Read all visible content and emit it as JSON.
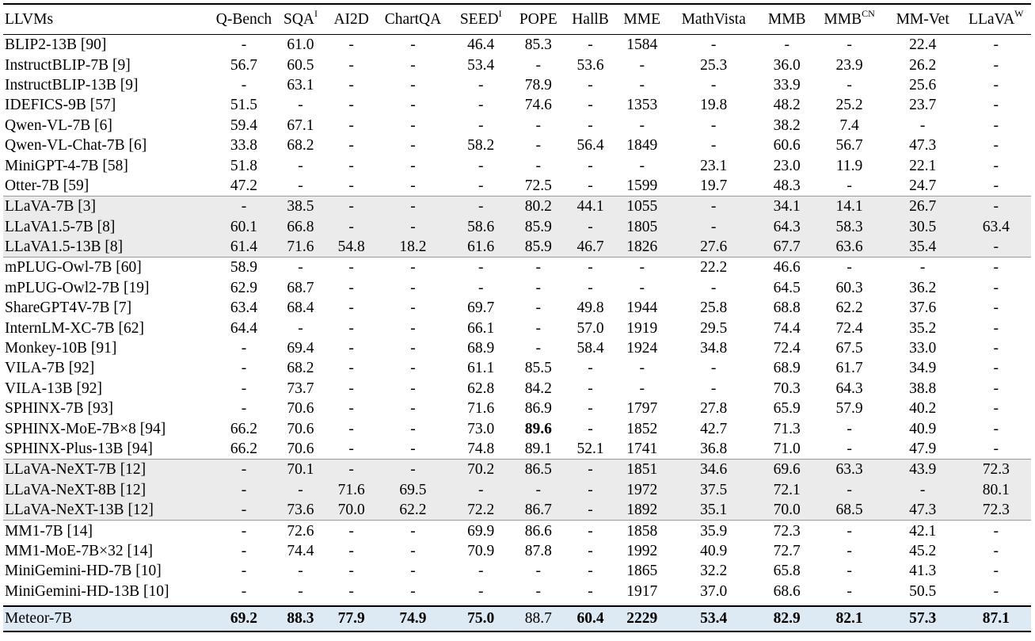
{
  "columns": [
    {
      "label": "LLVMs",
      "sup": ""
    },
    {
      "label": "Q-Bench",
      "sup": ""
    },
    {
      "label": "SQA",
      "sup": "I"
    },
    {
      "label": "AI2D",
      "sup": ""
    },
    {
      "label": "ChartQA",
      "sup": ""
    },
    {
      "label": "SEED",
      "sup": "I"
    },
    {
      "label": "POPE",
      "sup": ""
    },
    {
      "label": "HallB",
      "sup": ""
    },
    {
      "label": "MME",
      "sup": ""
    },
    {
      "label": "MathVista",
      "sup": ""
    },
    {
      "label": "MMB",
      "sup": ""
    },
    {
      "label": "MMB",
      "sup": "CN"
    },
    {
      "label": "MM-Vet",
      "sup": ""
    },
    {
      "label": "LLaVA",
      "sup": "W"
    }
  ],
  "rows": [
    {
      "model": "BLIP2-13B [90]",
      "values": [
        "-",
        "61.0",
        "-",
        "-",
        "46.4",
        "85.3",
        "-",
        "1584",
        "-",
        "-",
        "-",
        "22.4",
        "-"
      ]
    },
    {
      "model": "InstructBLIP-7B [9]",
      "values": [
        "56.7",
        "60.5",
        "-",
        "-",
        "53.4",
        "-",
        "53.6",
        "-",
        "25.3",
        "36.0",
        "23.9",
        "26.2",
        "-"
      ]
    },
    {
      "model": "InstructBLIP-13B [9]",
      "values": [
        "-",
        "63.1",
        "-",
        "-",
        "-",
        "78.9",
        "-",
        "-",
        "-",
        "33.9",
        "-",
        "25.6",
        "-"
      ]
    },
    {
      "model": "IDEFICS-9B [57]",
      "values": [
        "51.5",
        "-",
        "-",
        "-",
        "-",
        "74.6",
        "-",
        "1353",
        "19.8",
        "48.2",
        "25.2",
        "23.7",
        "-"
      ]
    },
    {
      "model": "Qwen-VL-7B [6]",
      "values": [
        "59.4",
        "67.1",
        "-",
        "-",
        "-",
        "-",
        "-",
        "-",
        "-",
        "38.2",
        "7.4",
        "-",
        "-"
      ]
    },
    {
      "model": "Qwen-VL-Chat-7B [6]",
      "values": [
        "33.8",
        "68.2",
        "-",
        "-",
        "58.2",
        "-",
        "56.4",
        "1849",
        "-",
        "60.6",
        "56.7",
        "47.3",
        "-"
      ]
    },
    {
      "model": "MiniGPT-4-7B [58]",
      "values": [
        "51.8",
        "-",
        "-",
        "-",
        "-",
        "-",
        "-",
        "-",
        "23.1",
        "23.0",
        "11.9",
        "22.1",
        "-"
      ]
    },
    {
      "model": "Otter-7B [59]",
      "values": [
        "47.2",
        "-",
        "-",
        "-",
        "-",
        "72.5",
        "-",
        "1599",
        "19.7",
        "48.3",
        "-",
        "24.7",
        "-"
      ]
    },
    {
      "model": "LLaVA-7B [3]",
      "values": [
        "-",
        "38.5",
        "-",
        "-",
        "-",
        "80.2",
        "44.1",
        "1055",
        "-",
        "34.1",
        "14.1",
        "26.7",
        "-"
      ],
      "shade": true,
      "group_start": true
    },
    {
      "model": "LLaVA1.5-7B [8]",
      "values": [
        "60.1",
        "66.8",
        "-",
        "-",
        "58.6",
        "85.9",
        "-",
        "1805",
        "-",
        "64.3",
        "58.3",
        "30.5",
        "63.4"
      ],
      "shade": true
    },
    {
      "model": "LLaVA1.5-13B [8]",
      "values": [
        "61.4",
        "71.6",
        "54.8",
        "18.2",
        "61.6",
        "85.9",
        "46.7",
        "1826",
        "27.6",
        "67.7",
        "63.6",
        "35.4",
        "-"
      ],
      "shade": true
    },
    {
      "model": "mPLUG-Owl-7B [60]",
      "values": [
        "58.9",
        "-",
        "-",
        "-",
        "-",
        "-",
        "-",
        "-",
        "22.2",
        "46.6",
        "-",
        "-",
        "-"
      ],
      "group_start": true
    },
    {
      "model": "mPLUG-Owl2-7B [19]",
      "values": [
        "62.9",
        "68.7",
        "-",
        "-",
        "-",
        "-",
        "-",
        "-",
        "-",
        "64.5",
        "60.3",
        "36.2",
        "-"
      ]
    },
    {
      "model": "ShareGPT4V-7B [7]",
      "values": [
        "63.4",
        "68.4",
        "-",
        "-",
        "69.7",
        "-",
        "49.8",
        "1944",
        "25.8",
        "68.8",
        "62.2",
        "37.6",
        "-"
      ]
    },
    {
      "model": "InternLM-XC-7B [62]",
      "values": [
        "64.4",
        "-",
        "-",
        "-",
        "66.1",
        "-",
        "57.0",
        "1919",
        "29.5",
        "74.4",
        "72.4",
        "35.2",
        "-"
      ]
    },
    {
      "model": "Monkey-10B [91]",
      "values": [
        "-",
        "69.4",
        "-",
        "-",
        "68.9",
        "-",
        "58.4",
        "1924",
        "34.8",
        "72.4",
        "67.5",
        "33.0",
        "-"
      ]
    },
    {
      "model": "VILA-7B [92]",
      "values": [
        "-",
        "68.2",
        "-",
        "-",
        "61.1",
        "85.5",
        "-",
        "-",
        "-",
        "68.9",
        "61.7",
        "34.9",
        "-"
      ]
    },
    {
      "model": "VILA-13B [92]",
      "values": [
        "-",
        "73.7",
        "-",
        "-",
        "62.8",
        "84.2",
        "-",
        "-",
        "-",
        "70.3",
        "64.3",
        "38.8",
        "-"
      ]
    },
    {
      "model": "SPHINX-7B [93]",
      "values": [
        "-",
        "70.6",
        "-",
        "-",
        "71.6",
        "86.9",
        "-",
        "1797",
        "27.8",
        "65.9",
        "57.9",
        "40.2",
        "-"
      ]
    },
    {
      "model": "SPHINX-MoE-7B×8 [94]",
      "values": [
        "66.2",
        "70.6",
        "-",
        "-",
        "73.0",
        "89.6",
        "-",
        "1852",
        "42.7",
        "71.3",
        "-",
        "40.9",
        "-"
      ],
      "bold_cols": [
        5
      ]
    },
    {
      "model": "SPHINX-Plus-13B [94]",
      "values": [
        "66.2",
        "70.6",
        "-",
        "-",
        "74.8",
        "89.1",
        "52.1",
        "1741",
        "36.8",
        "71.0",
        "-",
        "47.9",
        "-"
      ]
    },
    {
      "model": "LLaVA-NeXT-7B [12]",
      "values": [
        "-",
        "70.1",
        "-",
        "-",
        "70.2",
        "86.5",
        "-",
        "1851",
        "34.6",
        "69.6",
        "63.3",
        "43.9",
        "72.3"
      ],
      "shade": true,
      "group_start": true
    },
    {
      "model": "LLaVA-NeXT-8B [12]",
      "values": [
        "-",
        "-",
        "71.6",
        "69.5",
        "-",
        "-",
        "-",
        "1972",
        "37.5",
        "72.1",
        "-",
        "-",
        "80.1"
      ],
      "shade": true
    },
    {
      "model": "LLaVA-NeXT-13B [12]",
      "values": [
        "-",
        "73.6",
        "70.0",
        "62.2",
        "72.2",
        "86.7",
        "-",
        "1892",
        "35.1",
        "70.0",
        "68.5",
        "47.3",
        "72.3"
      ],
      "shade": true
    },
    {
      "model": "MM1-7B [14]",
      "values": [
        "-",
        "72.6",
        "-",
        "-",
        "69.9",
        "86.6",
        "-",
        "1858",
        "35.9",
        "72.3",
        "-",
        "42.1",
        "-"
      ],
      "group_start": true
    },
    {
      "model": "MM1-MoE-7B×32 [14]",
      "values": [
        "-",
        "74.4",
        "-",
        "-",
        "70.9",
        "87.8",
        "-",
        "1992",
        "40.9",
        "72.7",
        "-",
        "45.2",
        "-"
      ]
    },
    {
      "model": "MiniGemini-HD-7B [10]",
      "values": [
        "-",
        "-",
        "-",
        "-",
        "-",
        "-",
        "-",
        "1865",
        "32.2",
        "65.8",
        "-",
        "41.3",
        "-"
      ]
    },
    {
      "model": "MiniGemini-HD-13B [10]",
      "values": [
        "-",
        "-",
        "-",
        "-",
        "-",
        "-",
        "-",
        "1917",
        "37.0",
        "68.6",
        "-",
        "50.5",
        "-"
      ]
    }
  ],
  "final_row": {
    "model": "Meteor-7B",
    "values": [
      "69.2",
      "88.3",
      "77.9",
      "74.9",
      "75.0",
      "88.7",
      "60.4",
      "2229",
      "53.4",
      "82.9",
      "82.1",
      "57.3",
      "87.1"
    ],
    "bold_cols": [
      0,
      1,
      2,
      3,
      4,
      6,
      7,
      8,
      9,
      10,
      11,
      12
    ]
  }
}
